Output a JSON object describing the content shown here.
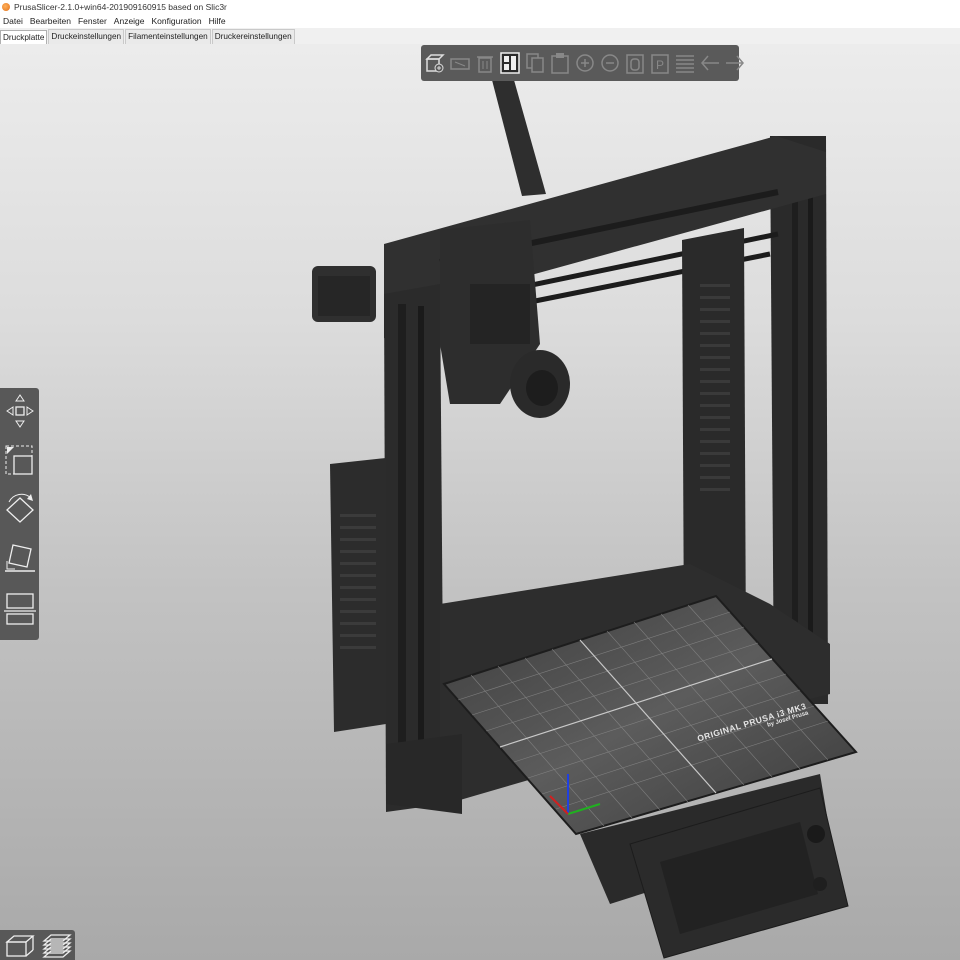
{
  "window": {
    "title": "PrusaSlicer-2.1.0+win64-201909160915 based on Slic3r"
  },
  "menu": [
    "Datei",
    "Bearbeiten",
    "Fenster",
    "Anzeige",
    "Konfiguration",
    "Hilfe"
  ],
  "tabs": [
    {
      "label": "Druckplatte",
      "active": true
    },
    {
      "label": "Druckeinstellungen",
      "active": false
    },
    {
      "label": "Filamenteinstellungen",
      "active": false
    },
    {
      "label": "Druckereinstellungen",
      "active": false
    }
  ],
  "top_toolbar": [
    {
      "icon": "add-object-icon"
    },
    {
      "icon": "delete-icon"
    },
    {
      "icon": "delete-all-icon"
    },
    {
      "icon": "arrange-icon"
    },
    {
      "icon": "copy-icon"
    },
    {
      "icon": "paste-icon"
    },
    {
      "icon": "add-instance-icon"
    },
    {
      "icon": "remove-instance-icon"
    },
    {
      "icon": "split-objects-icon"
    },
    {
      "icon": "split-parts-icon"
    },
    {
      "icon": "layers-editing-icon"
    },
    {
      "icon": "undo-icon"
    },
    {
      "icon": "redo-icon"
    }
  ],
  "left_toolbar": [
    {
      "icon": "move-icon"
    },
    {
      "icon": "scale-icon"
    },
    {
      "icon": "rotate-icon"
    },
    {
      "icon": "place-on-face-icon"
    },
    {
      "icon": "cut-icon"
    },
    {
      "icon": "support-points-icon"
    }
  ],
  "bottom_toolbar": [
    {
      "icon": "3d-view-icon"
    },
    {
      "icon": "preview-layers-icon"
    }
  ],
  "bed": {
    "label_line1": "ORIGINAL PRUSA i3 MK3",
    "label_line2": "by Josef Prusa"
  },
  "colors": {
    "viewport_top": "#ececec",
    "viewport_bottom": "#a9a9a9",
    "printer_body": "#2b2b2b",
    "toolbar_bg": "#5a5a5a",
    "bed_surface": "#4a4a4a",
    "axis_x": "#d02020",
    "axis_y": "#20b020",
    "axis_z": "#2040e0"
  }
}
